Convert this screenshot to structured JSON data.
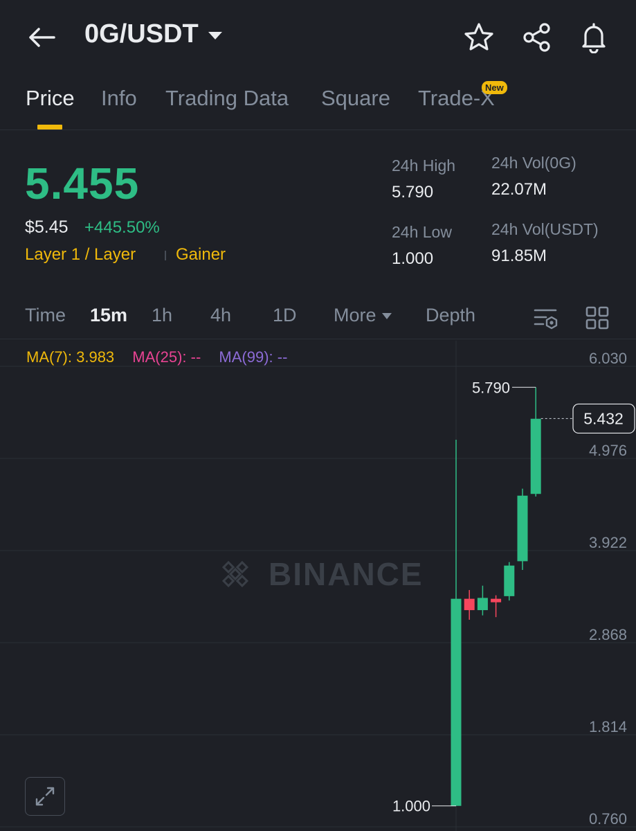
{
  "header": {
    "pair": "0G/USDT",
    "icons": [
      "back-arrow-icon",
      "star-icon",
      "share-icon",
      "bell-icon"
    ]
  },
  "tabs": [
    {
      "label": "Price",
      "active": true
    },
    {
      "label": "Info",
      "active": false
    },
    {
      "label": "Trading Data",
      "active": false
    },
    {
      "label": "Square",
      "active": false
    },
    {
      "label": "Trade-X",
      "active": false,
      "badge": "New"
    }
  ],
  "price": {
    "last": "5.455",
    "usd": "$5.45",
    "change": "+445.50%",
    "tags": [
      "Layer 1 / Layer",
      "Gainer"
    ]
  },
  "stats": {
    "high_label": "24h High",
    "high_value": "5.790",
    "low_label": "24h Low",
    "low_value": "1.000",
    "vol_base_label": "24h Vol(0G)",
    "vol_base_value": "22.07M",
    "vol_quote_label": "24h Vol(USDT)",
    "vol_quote_value": "91.85M"
  },
  "intervals": {
    "items": [
      {
        "label": "Time",
        "active": false
      },
      {
        "label": "15m",
        "active": true
      },
      {
        "label": "1h",
        "active": false
      },
      {
        "label": "4h",
        "active": false
      },
      {
        "label": "1D",
        "active": false
      },
      {
        "label": "More",
        "active": false
      },
      {
        "label": "Depth",
        "active": false
      }
    ],
    "icons": [
      "chart-settings-icon",
      "layout-grid-icon"
    ]
  },
  "ma": {
    "ma7": "MA(7): 3.983",
    "ma25": "MA(25): --",
    "ma99": "MA(99): --"
  },
  "colors": {
    "up": "#2ebd85",
    "down": "#f6465d",
    "accent": "#f0b90b",
    "ma7": "#f0b90b",
    "ma25": "#e84393",
    "ma99": "#8c6bd6"
  },
  "chart_data": {
    "type": "candlestick",
    "watermark": "BINANCE",
    "y_ticks": [
      "6.030",
      "4.976",
      "3.922",
      "2.868",
      "1.814",
      "0.760"
    ],
    "ylim": [
      0.76,
      6.03
    ],
    "high_marker": "5.790",
    "low_marker": "1.000",
    "current_price": "5.432",
    "candles": [
      {
        "open": 1.0,
        "high": 5.19,
        "low": 1.0,
        "close": 3.37
      },
      {
        "open": 3.37,
        "high": 3.47,
        "low": 3.13,
        "close": 3.24
      },
      {
        "open": 3.24,
        "high": 3.52,
        "low": 3.18,
        "close": 3.38
      },
      {
        "open": 3.37,
        "high": 3.41,
        "low": 3.16,
        "close": 3.33
      },
      {
        "open": 3.4,
        "high": 3.79,
        "low": 3.35,
        "close": 3.75
      },
      {
        "open": 3.8,
        "high": 4.63,
        "low": 3.7,
        "close": 4.55
      },
      {
        "open": 4.57,
        "high": 5.79,
        "low": 4.54,
        "close": 5.43
      }
    ]
  }
}
